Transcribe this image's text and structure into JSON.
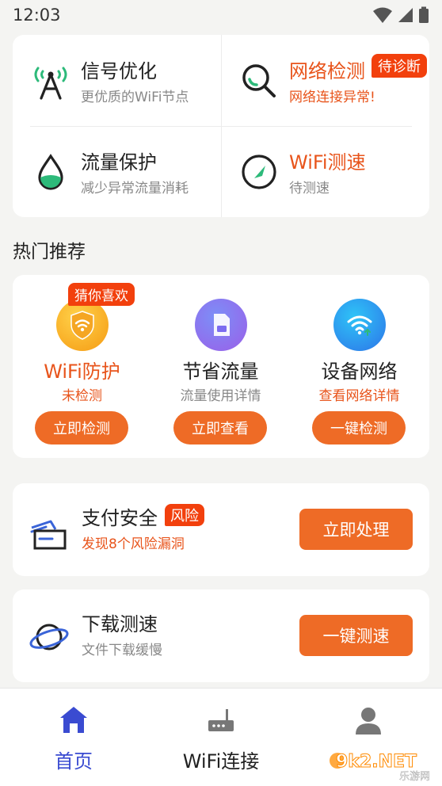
{
  "status_bar": {
    "time": "12:03"
  },
  "features": [
    {
      "title": "信号优化",
      "subtitle": "更优质的WiFi节点",
      "icon": "signal-tower-icon",
      "highlight": false
    },
    {
      "title": "网络检测",
      "subtitle": "网络连接异常!",
      "icon": "search-icon",
      "highlight": true,
      "badge": "待诊断"
    },
    {
      "title": "流量保护",
      "subtitle": "减少异常流量消耗",
      "icon": "water-drop-icon",
      "highlight": false
    },
    {
      "title": "WiFi测速",
      "subtitle": "待测速",
      "icon": "speedometer-icon",
      "highlight": "title"
    }
  ],
  "hot": {
    "title": "热门推荐",
    "tag": "猜你喜欢",
    "items": [
      {
        "name": "WiFi防护",
        "desc": "未检测",
        "button": "立即检测",
        "icon": "wifi-shield-icon"
      },
      {
        "name": "节省流量",
        "desc": "流量使用详情",
        "button": "立即查看",
        "icon": "sim-card-icon"
      },
      {
        "name": "设备网络",
        "desc": "查看网络详情",
        "button": "一键检测",
        "icon": "wifi-icon"
      }
    ]
  },
  "payment": {
    "title": "支付安全",
    "badge": "风险",
    "subtitle": "发现8个风险漏洞",
    "button": "立即处理",
    "icon": "payment-card-icon"
  },
  "download": {
    "title": "下载测速",
    "subtitle": "文件下载缓慢",
    "button": "一键测速",
    "icon": "planet-icon"
  },
  "nav": [
    {
      "label": "首页",
      "icon": "home-icon",
      "active": true
    },
    {
      "label": "WiFi连接",
      "icon": "router-icon",
      "active": false
    },
    {
      "label": "",
      "icon": "user-icon",
      "active": false
    }
  ],
  "watermark": {
    "brand": "9k2.NET",
    "sub": "乐游网"
  },
  "colors": {
    "accent": "#ee6b26",
    "alert": "#f2400d",
    "nav_active": "#3a4bd1"
  }
}
